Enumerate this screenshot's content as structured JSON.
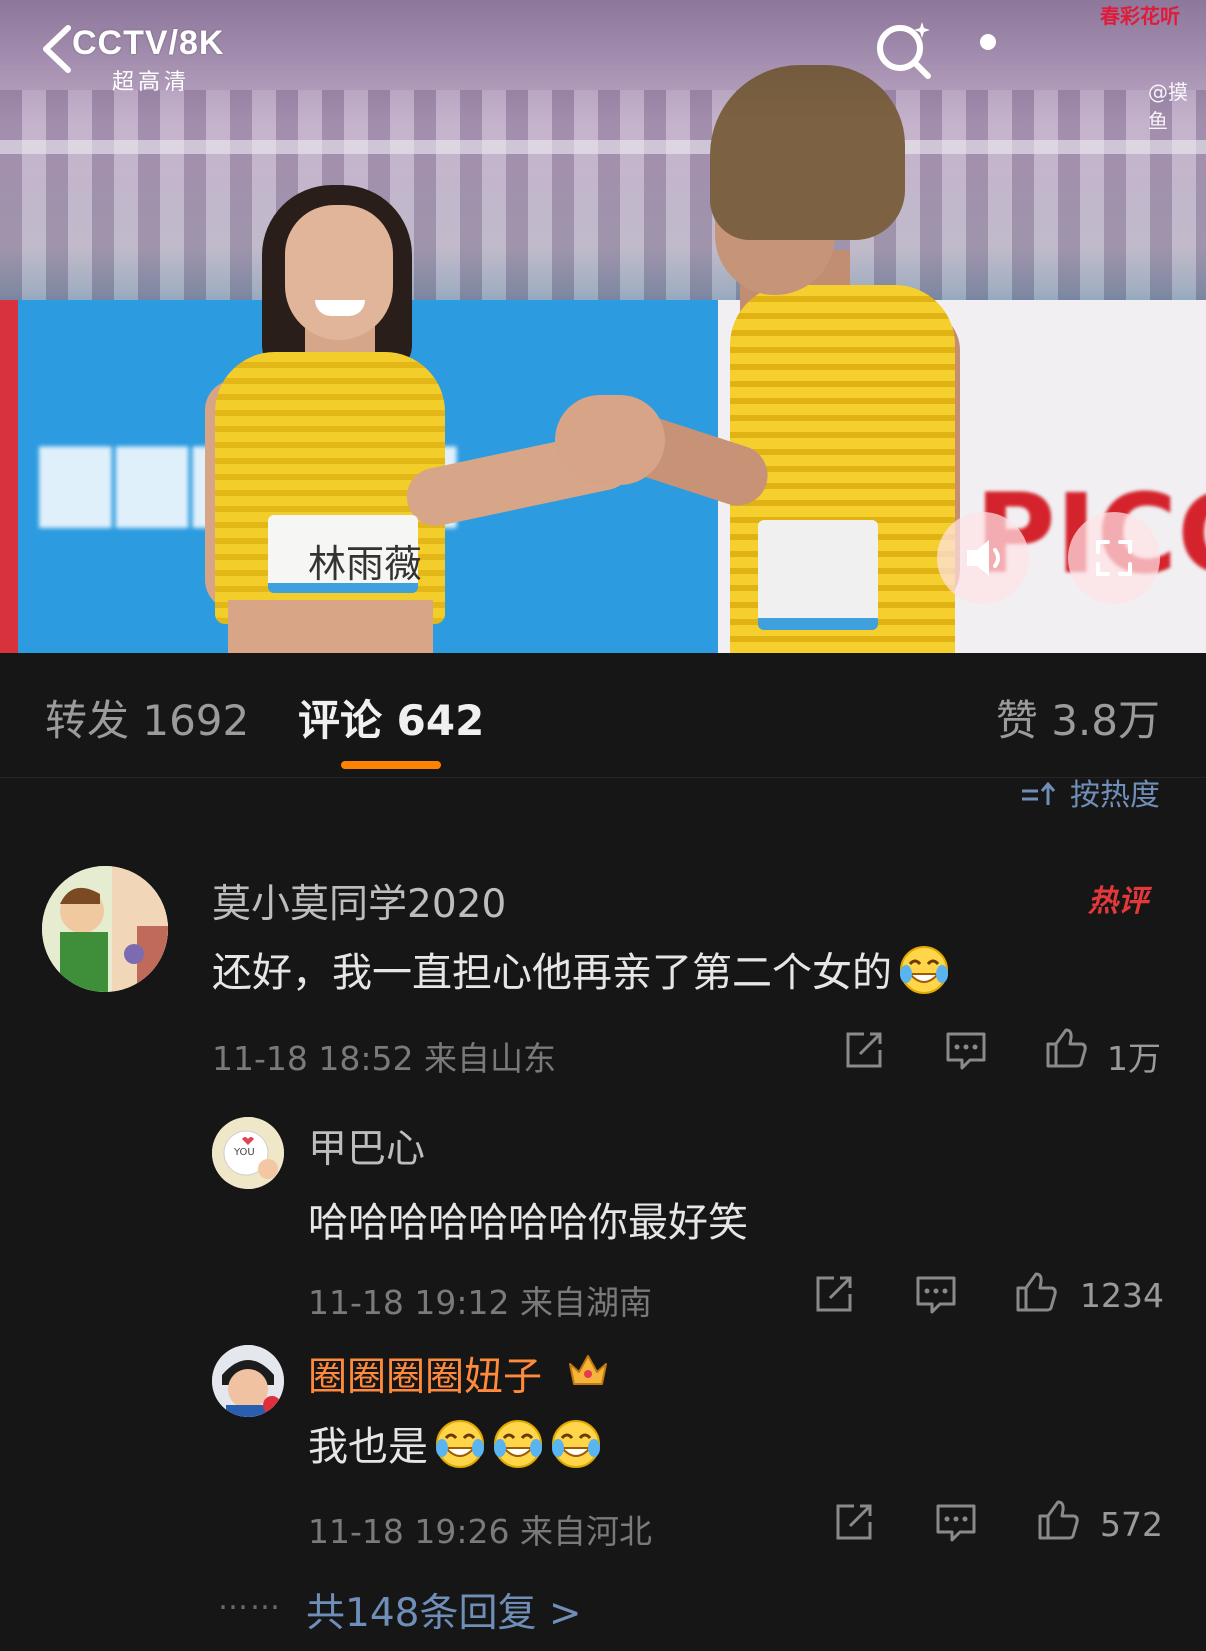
{
  "video": {
    "logo": "CCTV/8K",
    "logo_sub": "超高清",
    "watermark_top": "春彩花听",
    "watermark_handle": "@摸鱼",
    "bib_name": "林雨薇",
    "ad_brand": "PICC"
  },
  "tabs": {
    "repost": "转发 1692",
    "comments": "评论 642",
    "likes": "赞 3.8万"
  },
  "sort_label": "按热度",
  "comments": [
    {
      "name": "莫小莫同学2020",
      "badge": "热评",
      "text": "还好，我一直担心他再亲了第二个女的",
      "meta": "11-18 18:52 来自山东",
      "likes": "1万"
    }
  ],
  "replies": [
    {
      "name": "甲巴心",
      "text": "哈哈哈哈哈哈哈你最好笑",
      "meta": "11-18 19:12 来自湖南",
      "likes": "1234"
    },
    {
      "name": "圈圈圈圈妞子",
      "text": "我也是",
      "meta": "11-18 19:26 来自河北",
      "likes": "572"
    }
  ],
  "more_replies": "共148条回复 >",
  "dots": "……",
  "icons": [
    "back-icon",
    "search-icon",
    "more-icon",
    "volume-icon",
    "fullscreen-icon",
    "share-icon",
    "comment-icon",
    "like-icon",
    "laugh-cry-emoji",
    "crown-icon"
  ],
  "colors": {
    "accent": "#ff8200",
    "link": "#6f8fb8",
    "hot": "#e5383b",
    "background": "#161616"
  }
}
